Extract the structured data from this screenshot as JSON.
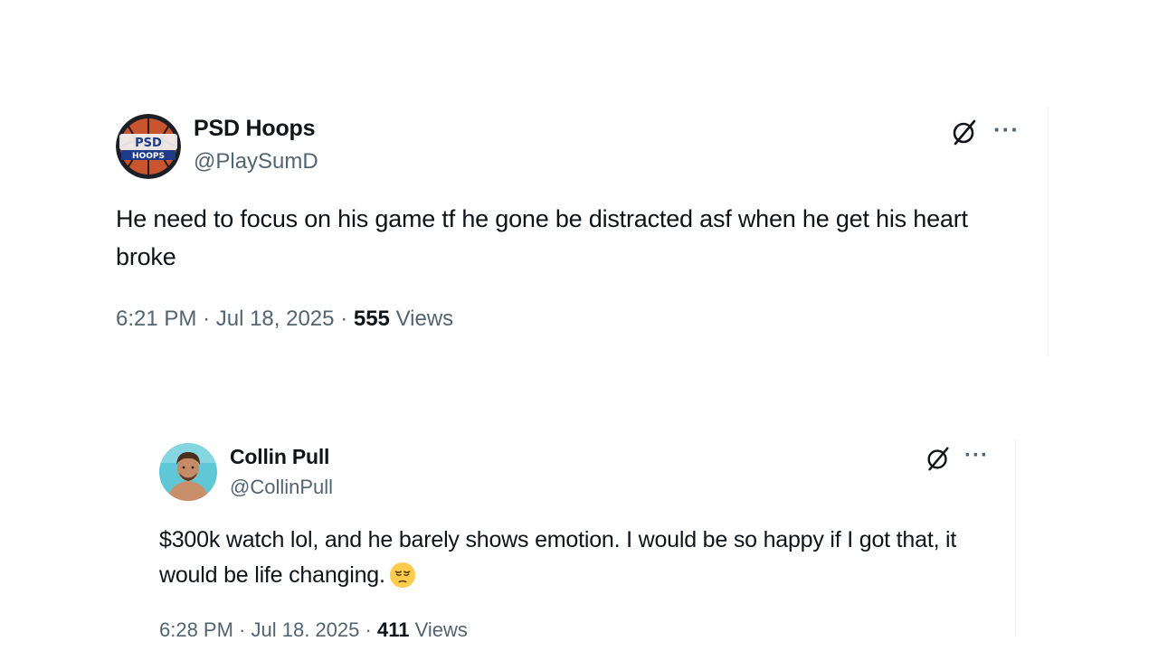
{
  "tweets": [
    {
      "author_name": "PSD Hoops",
      "handle": "@PlaySumD",
      "avatar_text_top": "PSD",
      "avatar_text_bottom": "HOOPS",
      "text": "He need to focus on his game tf he gone be distracted asf when he get his heart broke",
      "time": "6:21 PM",
      "date": "Jul 18, 2025",
      "separator": "·",
      "views_count": "555",
      "views_label": "Views",
      "emoji": ""
    },
    {
      "author_name": "Collin Pull",
      "handle": "@CollinPull",
      "text": "$300k watch lol, and he barely shows emotion. I would be so happy if I got that, it would be life changing.",
      "time": "6:28 PM",
      "date": "Jul 18, 2025",
      "separator": "·",
      "views_count": "411",
      "views_label": "Views",
      "emoji": "pensive-face"
    }
  ],
  "icons": {
    "grok": "grok-icon",
    "more": "more-icon",
    "more_glyph": "···"
  },
  "colors": {
    "primary_text": "#0f1419",
    "secondary_text": "#536471",
    "divider": "#eff3f4"
  }
}
